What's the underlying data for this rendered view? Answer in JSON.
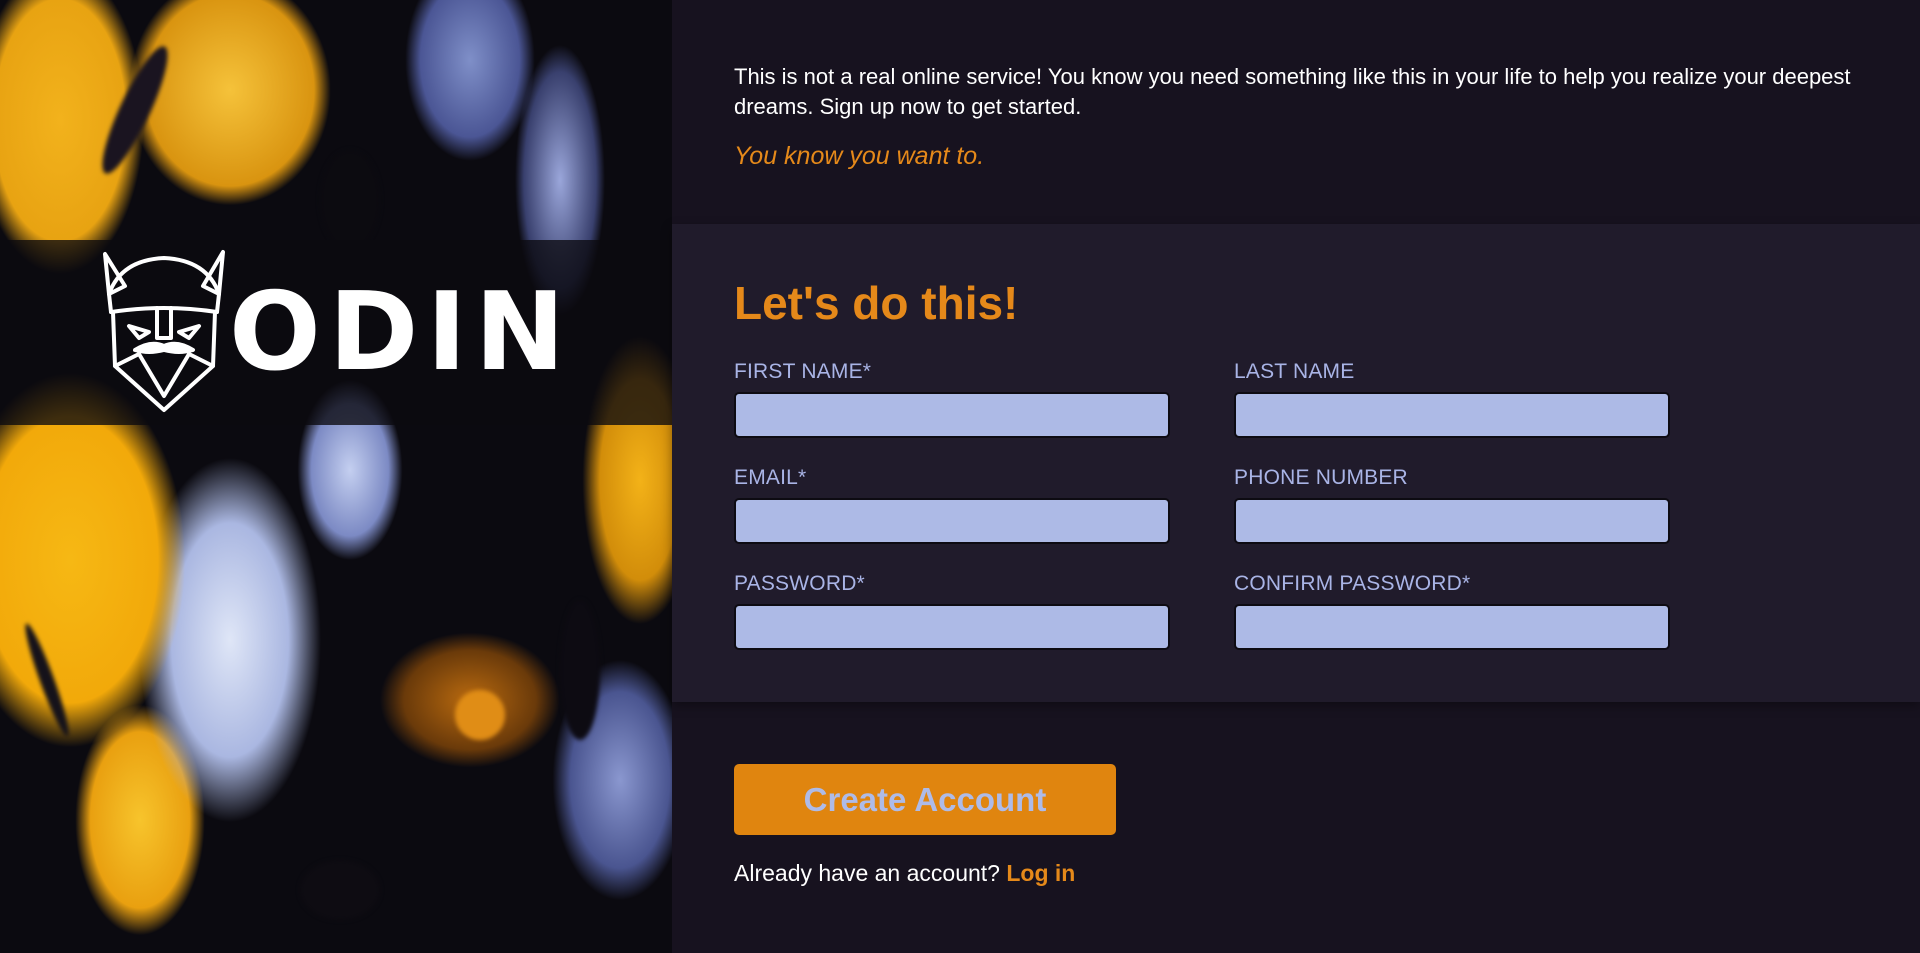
{
  "brand": {
    "logo_text": "ODIN"
  },
  "intro": {
    "text": "This is not a real online service! You know you need something like this in your life to help you realize your deepest dreams. Sign up now to get started.",
    "tagline": "You know you want to."
  },
  "form": {
    "title": "Let's do this!",
    "fields": [
      {
        "label": "FIRST NAME*",
        "value": "",
        "placeholder": ""
      },
      {
        "label": "LAST NAME",
        "value": "",
        "placeholder": ""
      },
      {
        "label": "EMAIL*",
        "value": "",
        "placeholder": ""
      },
      {
        "label": "PHONE NUMBER",
        "value": "",
        "placeholder": ""
      },
      {
        "label": "PASSWORD*",
        "value": "",
        "placeholder": ""
      },
      {
        "label": "CONFIRM PASSWORD*",
        "value": "",
        "placeholder": ""
      }
    ],
    "submit_label": "Create Account"
  },
  "login": {
    "prompt": "Already have an account?",
    "link_label": "Log in"
  },
  "colors": {
    "accent": "#e5891a",
    "page_bg": "#17121f",
    "panel_bg": "#201b2b",
    "label": "#a9b4e6",
    "input_bg": "#adbae6"
  },
  "icons": {
    "logo": "viking-helmet-icon"
  }
}
